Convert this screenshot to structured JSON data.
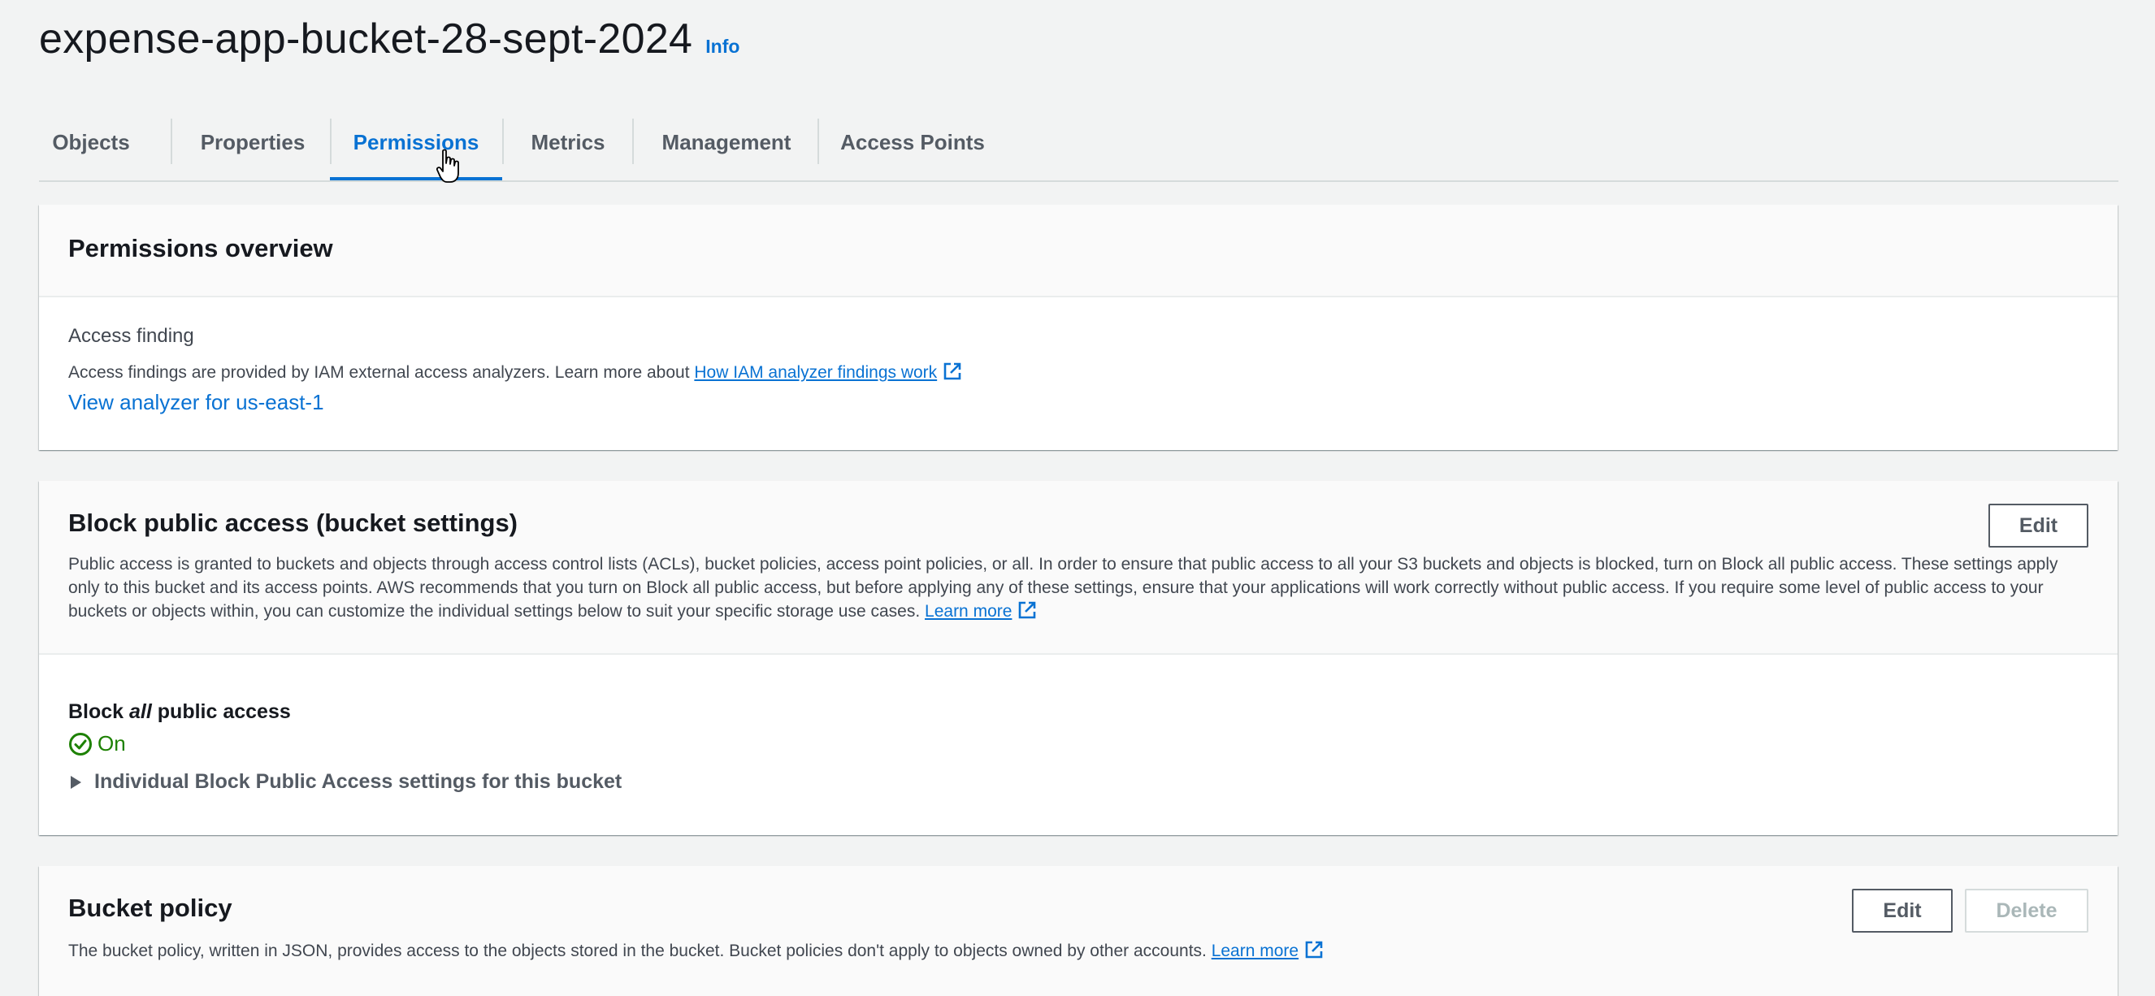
{
  "header": {
    "title": "expense-app-bucket-28-sept-2024",
    "info_label": "Info"
  },
  "tabs": [
    {
      "label": "Objects",
      "active": false
    },
    {
      "label": "Properties",
      "active": false
    },
    {
      "label": "Permissions",
      "active": true
    },
    {
      "label": "Metrics",
      "active": false
    },
    {
      "label": "Management",
      "active": false
    },
    {
      "label": "Access Points",
      "active": false
    }
  ],
  "permissions_overview": {
    "title": "Permissions overview",
    "access_finding_label": "Access finding",
    "description": "Access findings are provided by IAM external access analyzers. Learn more about ",
    "link_text": "How IAM analyzer findings work",
    "link_icon": "external-link-icon",
    "analyzer_link": "View analyzer for us-east-1"
  },
  "block_public_access": {
    "title": "Block public access (bucket settings)",
    "edit_label": "Edit",
    "description": "Public access is granted to buckets and objects through access control lists (ACLs), bucket policies, access point policies, or all. In order to ensure that public access to all your S3 buckets and objects is blocked, turn on Block all public access. These settings apply only to this bucket and its access points. AWS recommends that you turn on Block all public access, but before applying any of these settings, ensure that your applications will work correctly without public access. If you require some level of public access to your buckets or objects within, you can customize the individual settings below to suit your specific storage use cases. ",
    "learn_more": "Learn more",
    "block_all_prefix": "Block ",
    "block_all_emph": "all",
    "block_all_suffix": " public access",
    "status": "On",
    "status_icon": "check-circle-icon",
    "status_color": "#1d8102",
    "expander_label": "Individual Block Public Access settings for this bucket"
  },
  "bucket_policy": {
    "title": "Bucket policy",
    "edit_label": "Edit",
    "delete_label": "Delete",
    "description": "The bucket policy, written in JSON, provides access to the objects stored in the bucket. Bucket policies don't apply to objects owned by other accounts. ",
    "learn_more": "Learn more"
  },
  "colors": {
    "link": "#0972d3",
    "background": "#f2f3f3",
    "text": "#16191f"
  }
}
